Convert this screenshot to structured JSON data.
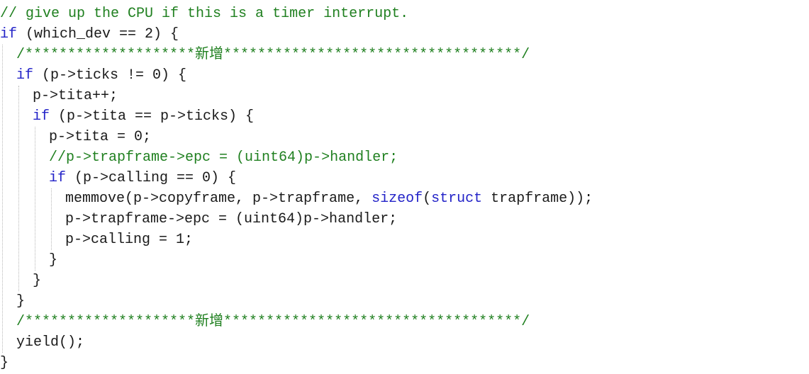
{
  "code": {
    "lines": [
      {
        "indent": 0,
        "tokens": [
          {
            "t": "// give up the CPU if this is a timer interrupt.",
            "c": "cm"
          }
        ]
      },
      {
        "indent": 0,
        "tokens": [
          {
            "t": "if",
            "c": "kw"
          },
          {
            "t": " (which_dev == 2) {",
            "c": "pl"
          }
        ]
      },
      {
        "indent": 1,
        "tokens": [
          {
            "t": "/********************新增***********************************/",
            "c": "cm"
          }
        ]
      },
      {
        "indent": 1,
        "tokens": [
          {
            "t": "if",
            "c": "kw"
          },
          {
            "t": " (p->ticks != 0) {",
            "c": "pl"
          }
        ]
      },
      {
        "indent": 2,
        "tokens": [
          {
            "t": "p->tita++;",
            "c": "pl"
          }
        ]
      },
      {
        "indent": 2,
        "tokens": [
          {
            "t": "if",
            "c": "kw"
          },
          {
            "t": " (p->tita == p->ticks) {",
            "c": "pl"
          }
        ]
      },
      {
        "indent": 3,
        "tokens": [
          {
            "t": "p->tita = 0;",
            "c": "pl"
          }
        ]
      },
      {
        "indent": 3,
        "tokens": [
          {
            "t": "//p->trapframe->epc = (uint64)p->handler;",
            "c": "cm"
          }
        ]
      },
      {
        "indent": 3,
        "tokens": [
          {
            "t": "if",
            "c": "kw"
          },
          {
            "t": " (p->calling == 0) {",
            "c": "pl"
          }
        ]
      },
      {
        "indent": 4,
        "tokens": [
          {
            "t": "memmove(p->copyframe, p->trapframe, ",
            "c": "pl"
          },
          {
            "t": "sizeof",
            "c": "kw"
          },
          {
            "t": "(",
            "c": "pl"
          },
          {
            "t": "struct",
            "c": "kw"
          },
          {
            "t": " trapframe));",
            "c": "pl"
          }
        ]
      },
      {
        "indent": 4,
        "tokens": [
          {
            "t": "p->trapframe->epc = (uint64)p->handler;",
            "c": "pl"
          }
        ]
      },
      {
        "indent": 4,
        "tokens": [
          {
            "t": "p->calling = 1;",
            "c": "pl"
          }
        ]
      },
      {
        "indent": 3,
        "tokens": [
          {
            "t": "}",
            "c": "pl"
          }
        ]
      },
      {
        "indent": 2,
        "tokens": [
          {
            "t": "}",
            "c": "pl"
          }
        ]
      },
      {
        "indent": 1,
        "tokens": [
          {
            "t": "}",
            "c": "pl"
          }
        ]
      },
      {
        "indent": 1,
        "tokens": [
          {
            "t": "/********************新增***********************************/",
            "c": "cm"
          }
        ]
      },
      {
        "indent": 1,
        "tokens": [
          {
            "t": "yield();",
            "c": "pl"
          }
        ]
      },
      {
        "indent": 0,
        "tokens": [
          {
            "t": "}",
            "c": "pl"
          }
        ]
      }
    ]
  },
  "colors": {
    "keyword": "#2323c8",
    "comment": "#208020",
    "plain": "#1a1a1a",
    "guide": "#b8b8b8",
    "background": "#ffffff"
  }
}
